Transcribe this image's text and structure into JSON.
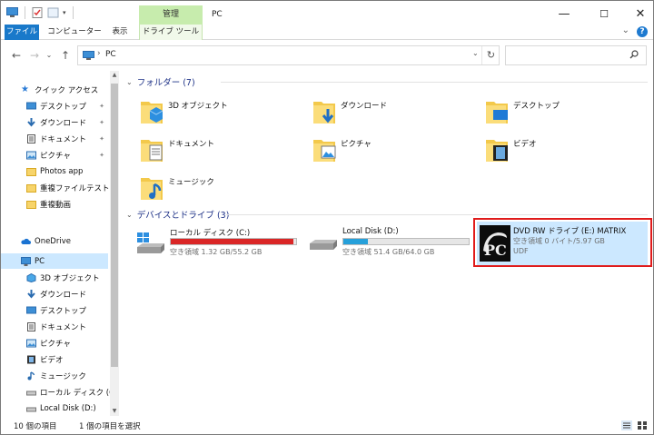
{
  "window": {
    "title": "PC",
    "manage_tab": "管理",
    "minimize": "—",
    "maximize": "☐",
    "close": "✕"
  },
  "ribbon": {
    "tabs": [
      "ファイル",
      "コンピューター",
      "表示",
      "ドライブ ツール"
    ],
    "collapse": "⌄",
    "help": "?"
  },
  "nav": {
    "back": "←",
    "forward": "→",
    "recent": "⌄",
    "up": "↑",
    "address": "PC",
    "address_chevron": "›",
    "dropdown": "⌄",
    "refresh": "↻",
    "search_placeholder": "",
    "search_icon": "🔍"
  },
  "sidebar": {
    "items": [
      {
        "label": "クイック アクセス",
        "icon": "star-icon",
        "pinned": false
      },
      {
        "label": "デスクトップ",
        "icon": "desktop-icon",
        "pinned": true
      },
      {
        "label": "ダウンロード",
        "icon": "download-icon",
        "pinned": true
      },
      {
        "label": "ドキュメント",
        "icon": "document-icon",
        "pinned": true
      },
      {
        "label": "ピクチャ",
        "icon": "pictures-icon",
        "pinned": true
      },
      {
        "label": "Photos app",
        "icon": "folder-icon",
        "pinned": false
      },
      {
        "label": "重複ファイルテスト",
        "icon": "folder-icon",
        "pinned": false
      },
      {
        "label": "重複動画",
        "icon": "folder-icon",
        "pinned": false
      },
      {
        "label": "OneDrive",
        "icon": "cloud-icon",
        "pinned": false
      },
      {
        "label": "PC",
        "icon": "pc-icon",
        "pinned": false
      },
      {
        "label": "3D オブジェクト",
        "icon": "3d-icon",
        "pinned": false
      },
      {
        "label": "ダウンロード",
        "icon": "download-icon",
        "pinned": false
      },
      {
        "label": "デスクトップ",
        "icon": "desktop-icon",
        "pinned": false
      },
      {
        "label": "ドキュメント",
        "icon": "document-icon",
        "pinned": false
      },
      {
        "label": "ピクチャ",
        "icon": "pictures-icon",
        "pinned": false
      },
      {
        "label": "ビデオ",
        "icon": "video-icon",
        "pinned": false
      },
      {
        "label": "ミュージック",
        "icon": "music-icon",
        "pinned": false
      },
      {
        "label": "ローカル ディスク (C:)",
        "icon": "drive-icon",
        "pinned": false
      },
      {
        "label": "Local Disk (D:)",
        "icon": "drive-icon",
        "pinned": false
      }
    ],
    "pin_glyph": "📌"
  },
  "folders": {
    "header": "フォルダー (7)",
    "items": [
      {
        "label": "3D オブジェクト",
        "icon": "3d-folder-icon"
      },
      {
        "label": "ダウンロード",
        "icon": "download-folder-icon"
      },
      {
        "label": "デスクトップ",
        "icon": "desktop-folder-icon"
      },
      {
        "label": "ドキュメント",
        "icon": "document-folder-icon"
      },
      {
        "label": "ピクチャ",
        "icon": "pictures-folder-icon"
      },
      {
        "label": "ビデオ",
        "icon": "video-folder-icon"
      },
      {
        "label": "ミュージック",
        "icon": "music-folder-icon"
      }
    ]
  },
  "drives": {
    "header": "デバイスとドライブ (3)",
    "items": [
      {
        "name": "ローカル ディスク (C:)",
        "free": "空き領域 1.32 GB/55.2 GB",
        "used_fraction": 0.976,
        "bar_color": "#da2626",
        "fs": ""
      },
      {
        "name": "Local Disk (D:)",
        "free": "空き領域 51.4 GB/64.0 GB",
        "used_fraction": 0.197,
        "bar_color": "#26a0da",
        "fs": ""
      },
      {
        "name": "DVD RW ドライブ (E:) MATRIX",
        "free": "空き領域 0 バイト/5.97 GB",
        "used_fraction": null,
        "bar_color": "",
        "fs": "UDF"
      }
    ]
  },
  "status": {
    "count": "10 個の項目",
    "selected": "1 個の項目を選択"
  }
}
